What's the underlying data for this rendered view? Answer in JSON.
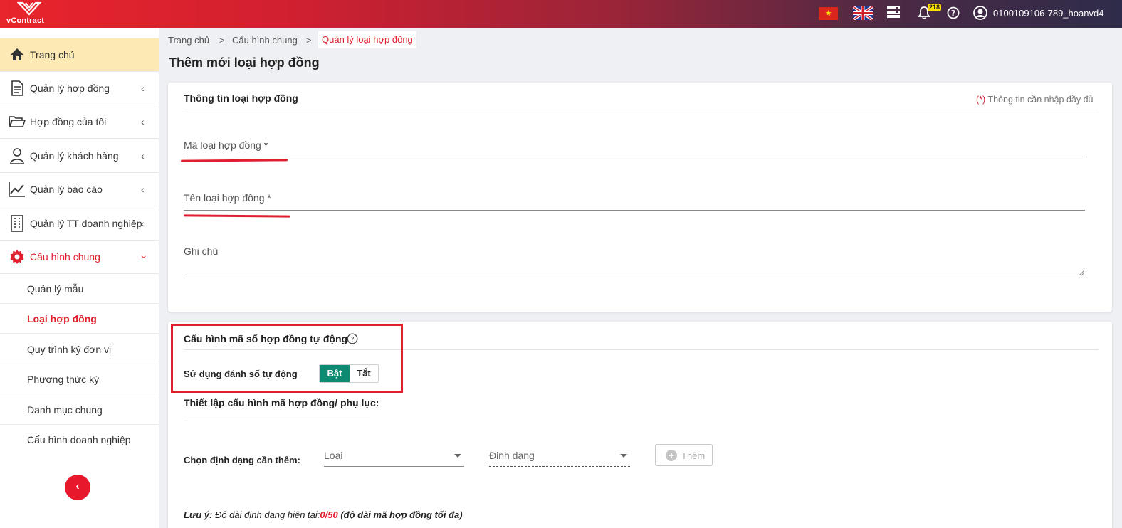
{
  "header": {
    "logo_text": "vContract",
    "notification_count": "218",
    "username": "0100109106-789_hoanvd4"
  },
  "sidebar": {
    "items": [
      {
        "label": "Trang chủ"
      },
      {
        "label": "Quản lý hợp đồng"
      },
      {
        "label": "Hợp đồng của tôi"
      },
      {
        "label": "Quản lý khách hàng"
      },
      {
        "label": "Quản lý báo cáo"
      },
      {
        "label": "Quản lý TT doanh nghiệp"
      },
      {
        "label": "Cấu hình chung"
      }
    ],
    "subitems": [
      {
        "label": "Quản lý mẫu"
      },
      {
        "label": "Loại hợp đồng"
      },
      {
        "label": "Quy trình ký đơn vị"
      },
      {
        "label": "Phương thức ký"
      },
      {
        "label": "Danh mục chung"
      },
      {
        "label": "Cấu hình doanh nghiệp"
      }
    ],
    "collapse_label": "‹"
  },
  "breadcrumb": {
    "home": "Trang chủ",
    "sep": ">",
    "parent": "Cấu hình chung",
    "current": "Quản lý loại hợp đồng"
  },
  "page_title": "Thêm mới loại hợp đồng",
  "info_section": {
    "title": "Thông tin loại hợp đồng",
    "required_star": "(*)",
    "required_note": " Thông tin cần nhập đầy đủ",
    "code_label": "Mã loại hợp đồng *",
    "name_label": "Tên loại hợp đồng *",
    "note_label": "Ghi chú"
  },
  "auto_number_section": {
    "title": "Cấu hình mã số hợp đồng tự động",
    "toggle_label": "Sử dụng đánh số tự động",
    "toggle_on": "Bật",
    "toggle_off": "Tắt",
    "toggle_value": "Bật",
    "setup_title": "Thiết lập cấu hình mã hợp đồng/ phụ lục:",
    "choose_format_label": "Chọn định dạng cần thêm:",
    "type_select": "Loại",
    "format_select": "Định dạng",
    "add_button": "Thêm",
    "note_prefix": "Lưu ý:",
    "note_text": " Độ dài định dạng hiện tại:",
    "note_value": "0/50",
    "note_suffix": " (độ dài mã hợp đồng tối đa)"
  },
  "colors": {
    "accent_red": "#e01f2e",
    "toggle_on": "#0e8a72",
    "home_highlight": "#fce9b3"
  }
}
